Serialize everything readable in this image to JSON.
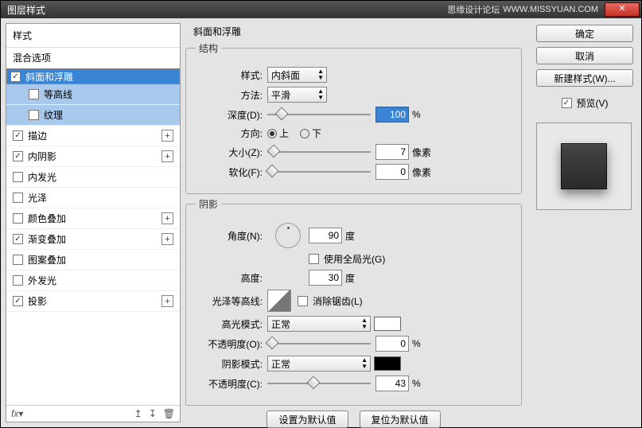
{
  "window": {
    "title": "图层样式",
    "brand": "思缘设计论坛",
    "url": "WWW.MISSYUAN.COM"
  },
  "sidebar": {
    "header": "样式",
    "blend_options": "混合选项",
    "items": [
      {
        "label": "斜面和浮雕",
        "checked": true,
        "selected": true
      },
      {
        "label": "等高线",
        "checked": false,
        "sub": true
      },
      {
        "label": "纹理",
        "checked": false,
        "sub": true
      },
      {
        "label": "描边",
        "checked": true,
        "plus": true
      },
      {
        "label": "内阴影",
        "checked": true,
        "plus": true
      },
      {
        "label": "内发光",
        "checked": false
      },
      {
        "label": "光泽",
        "checked": false
      },
      {
        "label": "颜色叠加",
        "checked": false,
        "plus": true
      },
      {
        "label": "渐变叠加",
        "checked": true,
        "plus": true
      },
      {
        "label": "图案叠加",
        "checked": false
      },
      {
        "label": "外发光",
        "checked": false
      },
      {
        "label": "投影",
        "checked": true,
        "plus": true
      }
    ]
  },
  "panel": {
    "title": "斜面和浮雕",
    "structure": {
      "legend": "结构",
      "style_label": "样式:",
      "style_value": "内斜面",
      "technique_label": "方法:",
      "technique_value": "平滑",
      "depth_label": "深度(D):",
      "depth_value": "100",
      "depth_unit": "%",
      "direction_label": "方向:",
      "up": "上",
      "down": "下",
      "size_label": "大小(Z):",
      "size_value": "7",
      "size_unit": "像素",
      "soften_label": "软化(F):",
      "soften_value": "0",
      "soften_unit": "像素"
    },
    "shading": {
      "legend": "阴影",
      "angle_label": "角度(N):",
      "angle_value": "90",
      "angle_unit": "度",
      "global_light": "使用全局光(G)",
      "altitude_label": "高度:",
      "altitude_value": "30",
      "altitude_unit": "度",
      "gloss_label": "光泽等高线:",
      "anti_alias": "消除锯齿(L)",
      "hilite_mode_label": "高光模式:",
      "hilite_mode_value": "正常",
      "hilite_op_label": "不透明度(O):",
      "hilite_op_value": "0",
      "hilite_op_unit": "%",
      "shadow_mode_label": "阴影模式:",
      "shadow_mode_value": "正常",
      "shadow_op_label": "不透明度(C):",
      "shadow_op_value": "43",
      "shadow_op_unit": "%"
    },
    "make_default": "设置为默认值",
    "reset_default": "复位为默认值"
  },
  "right": {
    "ok": "确定",
    "cancel": "取消",
    "new_style": "新建样式(W)...",
    "preview": "预览(V)"
  }
}
